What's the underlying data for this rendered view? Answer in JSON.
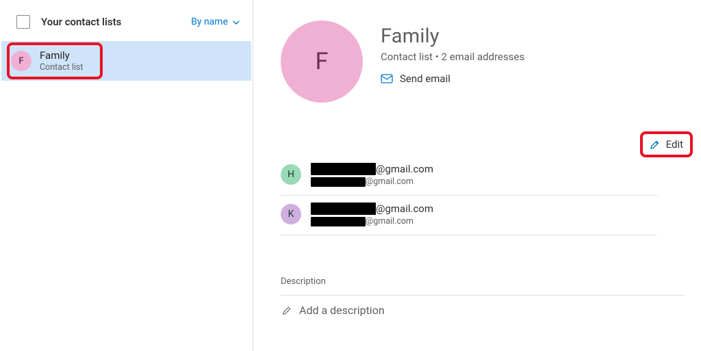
{
  "sidebar": {
    "title": "Your contact lists",
    "sort_label": "By name",
    "items": [
      {
        "initial": "F",
        "title": "Family",
        "subtitle": "Contact list"
      }
    ]
  },
  "detail": {
    "initial": "F",
    "name": "Family",
    "subtitle": "Contact list • 2 email addresses",
    "send_email_label": "Send email",
    "edit_label": "Edit",
    "members": [
      {
        "initial": "H",
        "avatar_color": "#9ad9b6",
        "domain": "@gmail.com",
        "sub_domain": "@gmail.com"
      },
      {
        "initial": "K",
        "avatar_color": "#d0aee0",
        "domain": "@gmail.com",
        "sub_domain": "@gmail.com"
      }
    ],
    "description_section_label": "Description",
    "description_placeholder": "Add a description"
  },
  "colors": {
    "accent": "#0078d4",
    "highlight": "#e81123"
  }
}
